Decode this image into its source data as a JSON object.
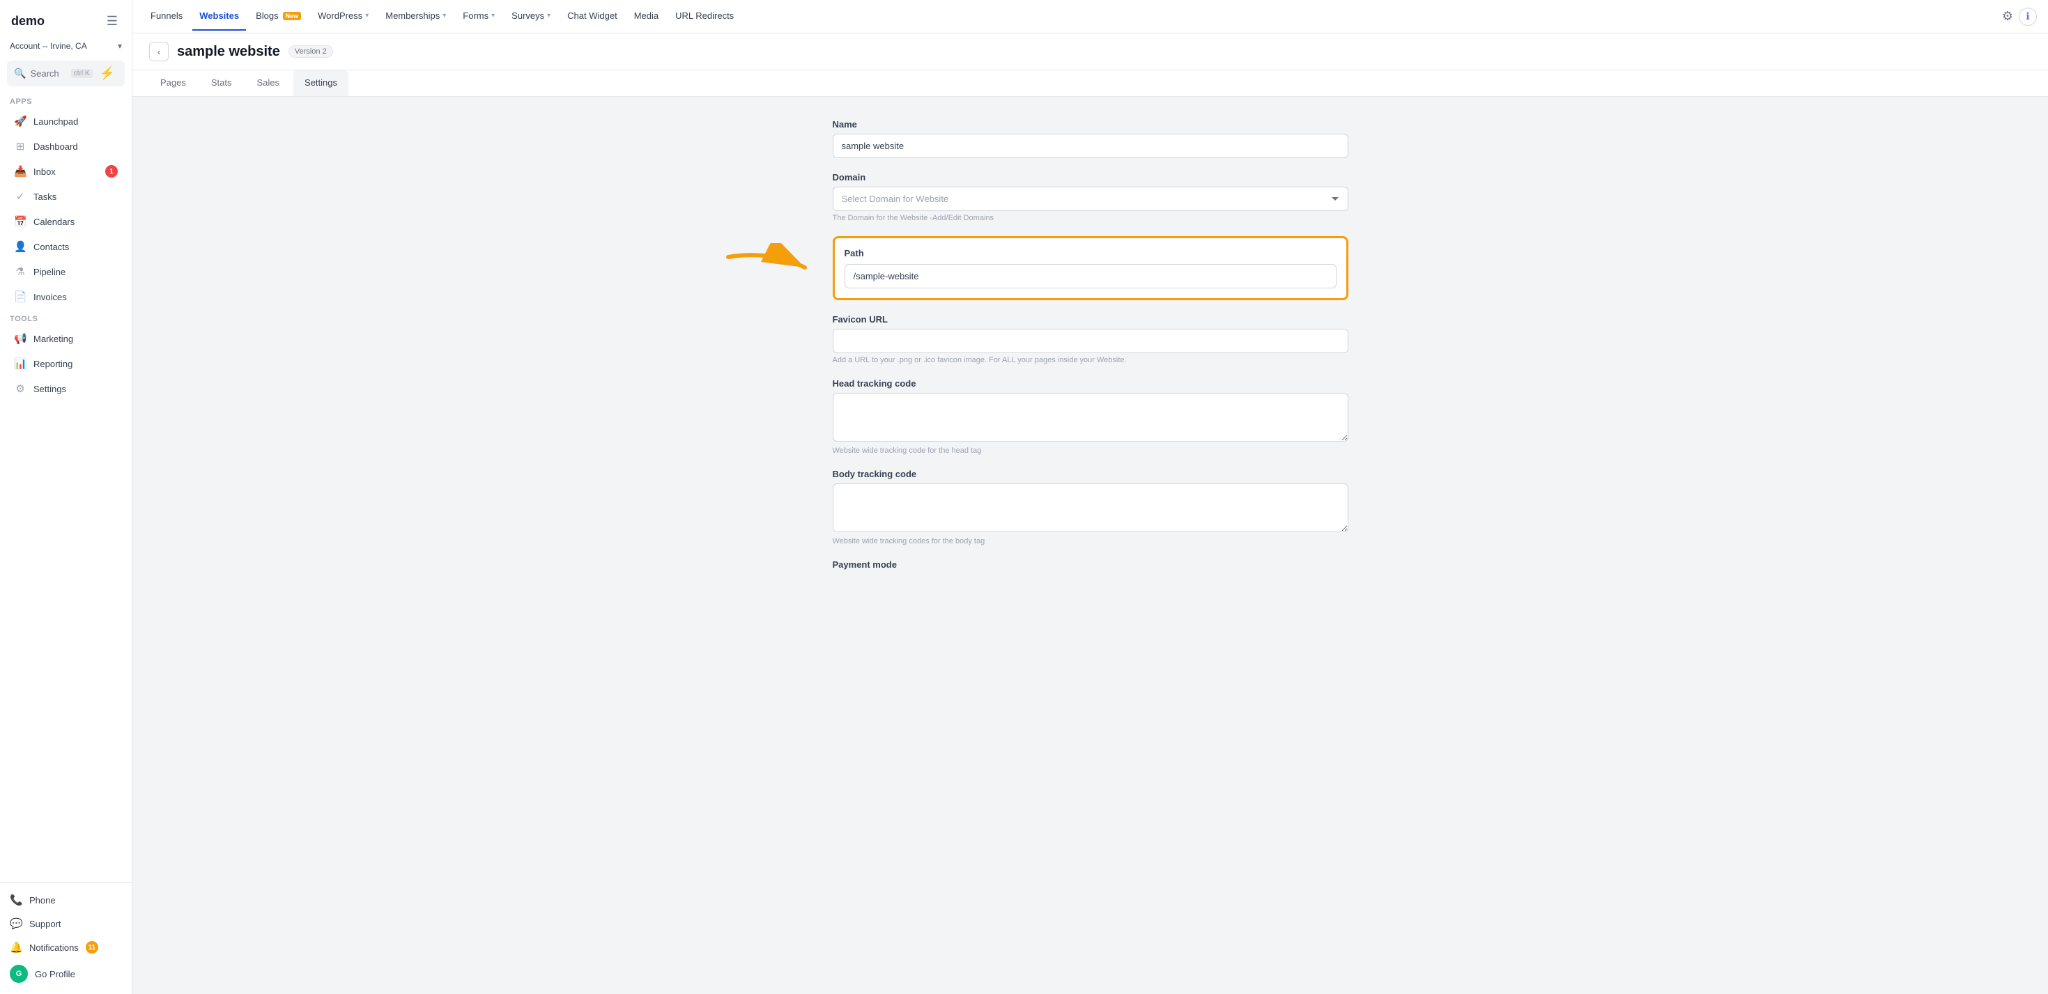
{
  "app": {
    "logo": "demo",
    "account": "Account -- Irvine, CA"
  },
  "sidebar": {
    "search_label": "Search",
    "search_shortcut": "ctrl K",
    "sections": {
      "apps_label": "Apps",
      "tools_label": "Tools"
    },
    "apps_items": [
      {
        "id": "launchpad",
        "label": "Launchpad",
        "icon": "🚀",
        "badge": null
      },
      {
        "id": "dashboard",
        "label": "Dashboard",
        "icon": "⊞",
        "badge": null
      },
      {
        "id": "inbox",
        "label": "Inbox",
        "icon": "📥",
        "badge": "1"
      },
      {
        "id": "tasks",
        "label": "Tasks",
        "icon": "✓",
        "badge": null
      },
      {
        "id": "calendars",
        "label": "Calendars",
        "icon": "📅",
        "badge": null
      },
      {
        "id": "contacts",
        "label": "Contacts",
        "icon": "👤",
        "badge": null
      },
      {
        "id": "pipeline",
        "label": "Pipeline",
        "icon": "⚗",
        "badge": null
      },
      {
        "id": "invoices",
        "label": "Invoices",
        "icon": "📄",
        "badge": null
      }
    ],
    "tools_items": [
      {
        "id": "marketing",
        "label": "Marketing",
        "icon": "📢",
        "badge": null
      },
      {
        "id": "reporting",
        "label": "Reporting",
        "icon": "📊",
        "badge": null
      },
      {
        "id": "settings",
        "label": "Settings",
        "icon": "⚙",
        "badge": null
      }
    ],
    "bottom_items": [
      {
        "id": "phone",
        "label": "Phone",
        "icon": "📞",
        "badge": null
      },
      {
        "id": "support",
        "label": "Support",
        "icon": "💬",
        "badge": null
      },
      {
        "id": "notifications",
        "label": "Notifications",
        "icon": "🔔",
        "badge": "11"
      },
      {
        "id": "profile",
        "label": "Go Profile",
        "icon": "avatar",
        "badge": null
      }
    ]
  },
  "topnav": {
    "items": [
      {
        "id": "funnels",
        "label": "Funnels",
        "has_chevron": false,
        "is_active": false,
        "is_new": false
      },
      {
        "id": "websites",
        "label": "Websites",
        "has_chevron": false,
        "is_active": true,
        "is_new": false
      },
      {
        "id": "blogs",
        "label": "Blogs",
        "has_chevron": false,
        "is_active": false,
        "is_new": true
      },
      {
        "id": "wordpress",
        "label": "WordPress",
        "has_chevron": true,
        "is_active": false,
        "is_new": false
      },
      {
        "id": "memberships",
        "label": "Memberships",
        "has_chevron": true,
        "is_active": false,
        "is_new": false
      },
      {
        "id": "forms",
        "label": "Forms",
        "has_chevron": true,
        "is_active": false,
        "is_new": false
      },
      {
        "id": "surveys",
        "label": "Surveys",
        "has_chevron": true,
        "is_active": false,
        "is_new": false
      },
      {
        "id": "chat_widget",
        "label": "Chat Widget",
        "has_chevron": false,
        "is_active": false,
        "is_new": false
      },
      {
        "id": "media",
        "label": "Media",
        "has_chevron": false,
        "is_active": false,
        "is_new": false
      },
      {
        "id": "url_redirects",
        "label": "URL Redirects",
        "has_chevron": false,
        "is_active": false,
        "is_new": false
      }
    ],
    "new_label": "New"
  },
  "page": {
    "title": "sample website",
    "version": "Version 2",
    "tabs": [
      {
        "id": "pages",
        "label": "Pages",
        "is_active": false
      },
      {
        "id": "stats",
        "label": "Stats",
        "is_active": false
      },
      {
        "id": "sales",
        "label": "Sales",
        "is_active": false
      },
      {
        "id": "settings",
        "label": "Settings",
        "is_active": true
      }
    ]
  },
  "form": {
    "name_label": "Name",
    "name_value": "sample website",
    "domain_label": "Domain",
    "domain_placeholder": "Select Domain for Website",
    "domain_hint": "The Domain for the Website -Add/Edit Domains",
    "path_label": "Path",
    "path_value": "/sample-website",
    "favicon_label": "Favicon URL",
    "favicon_hint": "Add a URL to your .png or .ico favicon image. For ALL your pages inside your Website.",
    "head_tracking_label": "Head tracking code",
    "head_tracking_hint": "Website wide tracking code for the head tag",
    "body_tracking_label": "Body tracking code",
    "body_tracking_hint": "Website wide tracking codes for the body tag",
    "payment_mode_label": "Payment mode"
  }
}
